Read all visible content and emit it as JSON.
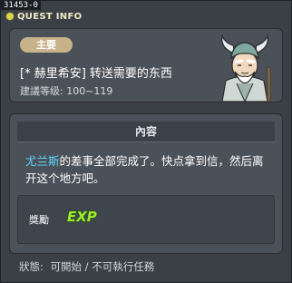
{
  "window": {
    "quest_id": "31453-0",
    "title": "QUEST INFO"
  },
  "header": {
    "badge": "主要",
    "quest_title": "[* 赫里希安] 转送需要的东西",
    "level_label": "建議等级:",
    "level_range": "100~119"
  },
  "content": {
    "section_title": "內容",
    "description_npc": "尤兰斯",
    "description_rest": "的差事全部完成了。快点拿到信，然后离开这个地方吧。",
    "reward_label": "獎勵",
    "reward_icon_text": "EXP"
  },
  "status": {
    "label": "狀態:",
    "value": "可開始 / 不可執行任務"
  },
  "colors": {
    "background": "#3b4047",
    "panel": "#4b5158",
    "badge": "#c7b28a",
    "npc_name": "#5ed5ff",
    "exp_green": "#9ee82e"
  },
  "icons": {
    "title_bullet": "yellow-dot-icon",
    "npc": "old-sage-npc-icon",
    "reward": "exp-icon"
  }
}
